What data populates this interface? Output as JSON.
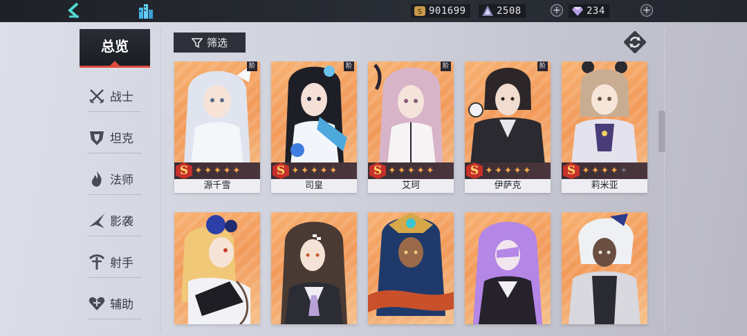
{
  "topbar": {
    "back_icon": "chevron-left-icon",
    "home_icon": "city-icon",
    "gold": "901699",
    "crystal": "2508",
    "gem": "234"
  },
  "nav": {
    "overview": "总览",
    "items": [
      {
        "label": "战士",
        "icon": "crossed-swords-icon"
      },
      {
        "label": "坦克",
        "icon": "shield-icon"
      },
      {
        "label": "法师",
        "icon": "flame-icon"
      },
      {
        "label": "影袭",
        "icon": "shadow-blade-icon"
      },
      {
        "label": "射手",
        "icon": "bow-icon"
      },
      {
        "label": "辅助",
        "icon": "heart-icon"
      }
    ]
  },
  "toolbar": {
    "filter_label": "筛选",
    "refresh_icon": "refresh-icon"
  },
  "cards": {
    "row1": [
      {
        "name": "源千雪",
        "tier": "S",
        "stars": 5
      },
      {
        "name": "司皇",
        "tier": "S",
        "stars": 5
      },
      {
        "name": "艾珂",
        "tier": "S",
        "stars": 5
      },
      {
        "name": "伊萨克",
        "tier": "S",
        "stars": 5
      },
      {
        "name": "莉米亚",
        "tier": "S",
        "stars": 4
      }
    ],
    "row2": [
      {
        "name": ""
      },
      {
        "name": ""
      },
      {
        "name": ""
      },
      {
        "name": ""
      },
      {
        "name": ""
      }
    ]
  },
  "colors": {
    "accent_red": "#e04a3c",
    "back_cyan": "#4fd6d0",
    "card_orange": "#f29a5a",
    "star": "#f3a64a"
  }
}
